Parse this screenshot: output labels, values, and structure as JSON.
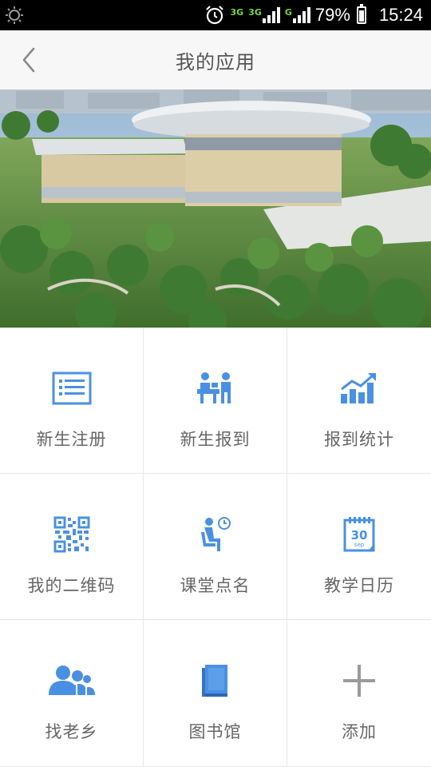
{
  "status_bar": {
    "network_1": "3G",
    "network_2": "3G",
    "network_3": "G",
    "battery": "79%",
    "time": "15:24",
    "icons": [
      "brightness-icon",
      "alarm-icon",
      "signal-icon",
      "battery-icon"
    ]
  },
  "header": {
    "title": "我的应用",
    "back_icon": "chevron-left-icon"
  },
  "banner": {
    "image": "campus-stadium-photo"
  },
  "apps": [
    {
      "label": "新生注册",
      "icon": "registration-list-icon"
    },
    {
      "label": "新生报到",
      "icon": "check-in-desk-icon"
    },
    {
      "label": "报到统计",
      "icon": "statistics-chart-icon"
    },
    {
      "label": "我的二维码",
      "icon": "qr-code-icon"
    },
    {
      "label": "课堂点名",
      "icon": "roll-call-icon"
    },
    {
      "label": "教学日历",
      "icon": "calendar-icon"
    },
    {
      "label": "找老乡",
      "icon": "people-group-icon"
    },
    {
      "label": "图书馆",
      "icon": "library-book-icon"
    },
    {
      "label": "添加",
      "icon": "add-plus-icon"
    }
  ],
  "calendar_icon_text": {
    "day": "30",
    "month": "sep"
  },
  "colors": {
    "accent": "#4a90e2",
    "status_bar": "#000000",
    "header_bg": "#f7f7f7",
    "label_text": "#666666",
    "add_icon": "#9a9a9a"
  }
}
